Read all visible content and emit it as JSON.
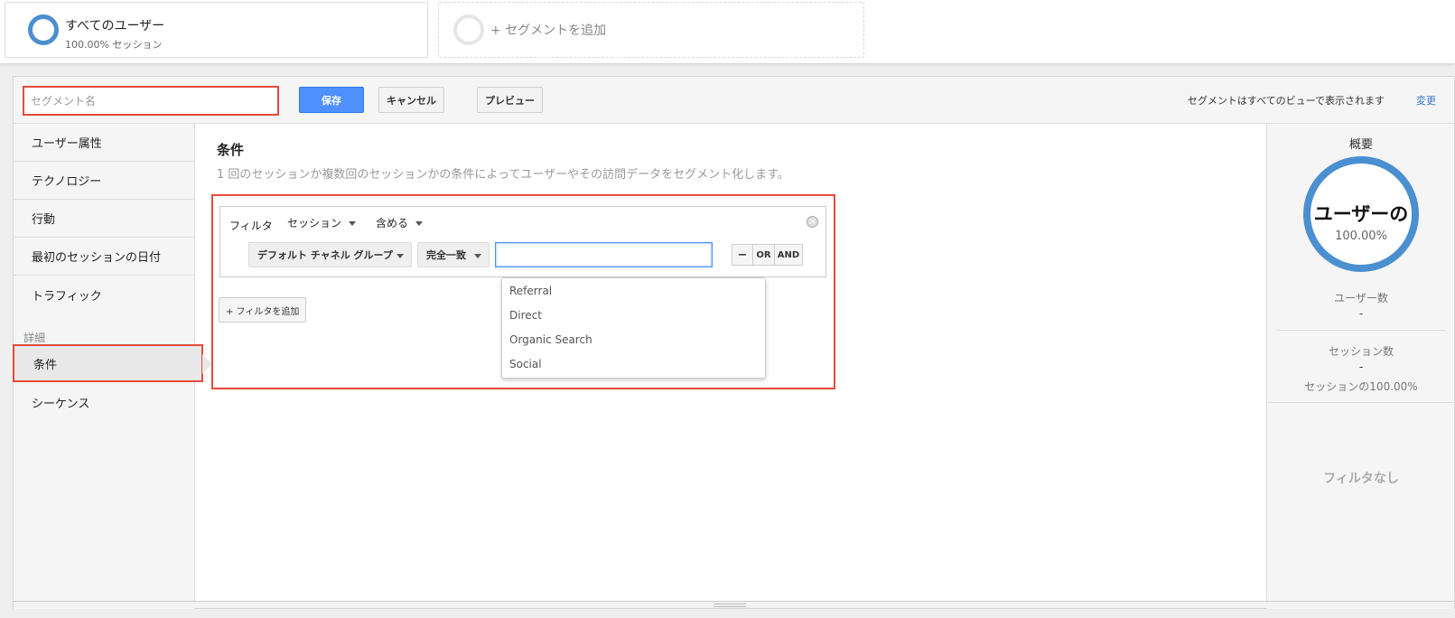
{
  "segments": {
    "active": {
      "title": "すべてのユーザー",
      "subtitle": "100.00% セッション"
    },
    "add_label": "+ セグメントを追加"
  },
  "toolbar": {
    "name_placeholder": "セグメント名",
    "save_label": "保存",
    "cancel_label": "キャンセル",
    "preview_label": "プレビュー",
    "note": "セグメントはすべてのビューで表示されます",
    "change_link": "変更"
  },
  "nav": {
    "items": [
      {
        "label": "ユーザー属性"
      },
      {
        "label": "テクノロジー"
      },
      {
        "label": "行動"
      },
      {
        "label": "最初のセッションの日付"
      },
      {
        "label": "トラフィック"
      }
    ],
    "section_label": "詳細",
    "advanced": [
      {
        "label": "条件",
        "selected": true
      },
      {
        "label": "シーケンス"
      }
    ]
  },
  "content": {
    "title": "条件",
    "description": "1 回のセッションか複数回のセッションかの条件によってユーザーやその訪問データをセグメント化します。",
    "filter": {
      "label": "フィルタ",
      "scope": "セッション",
      "match": "含める",
      "dimension": "デフォルト チャネル グループ",
      "operator": "完全一致",
      "value": "",
      "ops": {
        "minus": "−",
        "or": "OR",
        "and": "AND"
      },
      "suggestions": [
        "Referral",
        "Direct",
        "Organic Search",
        "Social"
      ]
    },
    "add_filter_label": "+ フィルタを追加"
  },
  "summary": {
    "title": "概要",
    "ring_label": "ユーザーの",
    "ring_pct": "100.00%",
    "users_label": "ユーザー数",
    "users_value": "-",
    "sessions_label": "セッション数",
    "sessions_value": "-",
    "sessions_pct": "セッションの100.00%",
    "no_filter": "フィルタなし"
  },
  "colors": {
    "accent_blue": "#4d90fe",
    "ring_blue": "#4a8fd0",
    "highlight_red": "#e64a3b",
    "link_blue": "#3a76c4"
  }
}
